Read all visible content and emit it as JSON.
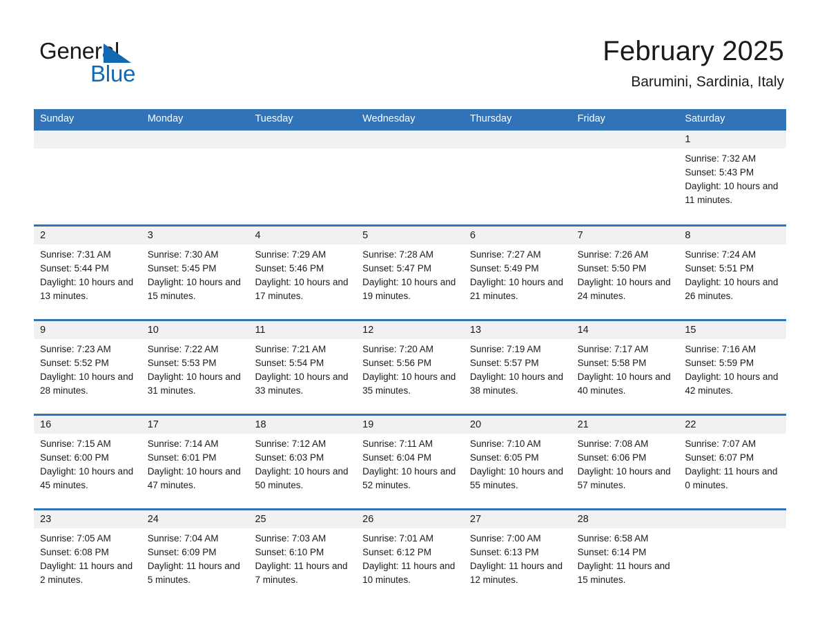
{
  "brand": {
    "name_top": "General",
    "name_bottom": "Blue",
    "triangle_color": "#1268b3",
    "accent_color": "#3173b8"
  },
  "header": {
    "month_title": "February 2025",
    "location": "Barumini, Sardinia, Italy"
  },
  "calendar": {
    "weekday_headers": [
      "Sunday",
      "Monday",
      "Tuesday",
      "Wednesday",
      "Thursday",
      "Friday",
      "Saturday"
    ],
    "weeks": [
      {
        "days": [
          {
            "num": "",
            "sunrise": "",
            "sunset": "",
            "daylight": ""
          },
          {
            "num": "",
            "sunrise": "",
            "sunset": "",
            "daylight": ""
          },
          {
            "num": "",
            "sunrise": "",
            "sunset": "",
            "daylight": ""
          },
          {
            "num": "",
            "sunrise": "",
            "sunset": "",
            "daylight": ""
          },
          {
            "num": "",
            "sunrise": "",
            "sunset": "",
            "daylight": ""
          },
          {
            "num": "",
            "sunrise": "",
            "sunset": "",
            "daylight": ""
          },
          {
            "num": "1",
            "sunrise": "Sunrise: 7:32 AM",
            "sunset": "Sunset: 5:43 PM",
            "daylight": "Daylight: 10 hours and 11 minutes."
          }
        ]
      },
      {
        "days": [
          {
            "num": "2",
            "sunrise": "Sunrise: 7:31 AM",
            "sunset": "Sunset: 5:44 PM",
            "daylight": "Daylight: 10 hours and 13 minutes."
          },
          {
            "num": "3",
            "sunrise": "Sunrise: 7:30 AM",
            "sunset": "Sunset: 5:45 PM",
            "daylight": "Daylight: 10 hours and 15 minutes."
          },
          {
            "num": "4",
            "sunrise": "Sunrise: 7:29 AM",
            "sunset": "Sunset: 5:46 PM",
            "daylight": "Daylight: 10 hours and 17 minutes."
          },
          {
            "num": "5",
            "sunrise": "Sunrise: 7:28 AM",
            "sunset": "Sunset: 5:47 PM",
            "daylight": "Daylight: 10 hours and 19 minutes."
          },
          {
            "num": "6",
            "sunrise": "Sunrise: 7:27 AM",
            "sunset": "Sunset: 5:49 PM",
            "daylight": "Daylight: 10 hours and 21 minutes."
          },
          {
            "num": "7",
            "sunrise": "Sunrise: 7:26 AM",
            "sunset": "Sunset: 5:50 PM",
            "daylight": "Daylight: 10 hours and 24 minutes."
          },
          {
            "num": "8",
            "sunrise": "Sunrise: 7:24 AM",
            "sunset": "Sunset: 5:51 PM",
            "daylight": "Daylight: 10 hours and 26 minutes."
          }
        ]
      },
      {
        "days": [
          {
            "num": "9",
            "sunrise": "Sunrise: 7:23 AM",
            "sunset": "Sunset: 5:52 PM",
            "daylight": "Daylight: 10 hours and 28 minutes."
          },
          {
            "num": "10",
            "sunrise": "Sunrise: 7:22 AM",
            "sunset": "Sunset: 5:53 PM",
            "daylight": "Daylight: 10 hours and 31 minutes."
          },
          {
            "num": "11",
            "sunrise": "Sunrise: 7:21 AM",
            "sunset": "Sunset: 5:54 PM",
            "daylight": "Daylight: 10 hours and 33 minutes."
          },
          {
            "num": "12",
            "sunrise": "Sunrise: 7:20 AM",
            "sunset": "Sunset: 5:56 PM",
            "daylight": "Daylight: 10 hours and 35 minutes."
          },
          {
            "num": "13",
            "sunrise": "Sunrise: 7:19 AM",
            "sunset": "Sunset: 5:57 PM",
            "daylight": "Daylight: 10 hours and 38 minutes."
          },
          {
            "num": "14",
            "sunrise": "Sunrise: 7:17 AM",
            "sunset": "Sunset: 5:58 PM",
            "daylight": "Daylight: 10 hours and 40 minutes."
          },
          {
            "num": "15",
            "sunrise": "Sunrise: 7:16 AM",
            "sunset": "Sunset: 5:59 PM",
            "daylight": "Daylight: 10 hours and 42 minutes."
          }
        ]
      },
      {
        "days": [
          {
            "num": "16",
            "sunrise": "Sunrise: 7:15 AM",
            "sunset": "Sunset: 6:00 PM",
            "daylight": "Daylight: 10 hours and 45 minutes."
          },
          {
            "num": "17",
            "sunrise": "Sunrise: 7:14 AM",
            "sunset": "Sunset: 6:01 PM",
            "daylight": "Daylight: 10 hours and 47 minutes."
          },
          {
            "num": "18",
            "sunrise": "Sunrise: 7:12 AM",
            "sunset": "Sunset: 6:03 PM",
            "daylight": "Daylight: 10 hours and 50 minutes."
          },
          {
            "num": "19",
            "sunrise": "Sunrise: 7:11 AM",
            "sunset": "Sunset: 6:04 PM",
            "daylight": "Daylight: 10 hours and 52 minutes."
          },
          {
            "num": "20",
            "sunrise": "Sunrise: 7:10 AM",
            "sunset": "Sunset: 6:05 PM",
            "daylight": "Daylight: 10 hours and 55 minutes."
          },
          {
            "num": "21",
            "sunrise": "Sunrise: 7:08 AM",
            "sunset": "Sunset: 6:06 PM",
            "daylight": "Daylight: 10 hours and 57 minutes."
          },
          {
            "num": "22",
            "sunrise": "Sunrise: 7:07 AM",
            "sunset": "Sunset: 6:07 PM",
            "daylight": "Daylight: 11 hours and 0 minutes."
          }
        ]
      },
      {
        "days": [
          {
            "num": "23",
            "sunrise": "Sunrise: 7:05 AM",
            "sunset": "Sunset: 6:08 PM",
            "daylight": "Daylight: 11 hours and 2 minutes."
          },
          {
            "num": "24",
            "sunrise": "Sunrise: 7:04 AM",
            "sunset": "Sunset: 6:09 PM",
            "daylight": "Daylight: 11 hours and 5 minutes."
          },
          {
            "num": "25",
            "sunrise": "Sunrise: 7:03 AM",
            "sunset": "Sunset: 6:10 PM",
            "daylight": "Daylight: 11 hours and 7 minutes."
          },
          {
            "num": "26",
            "sunrise": "Sunrise: 7:01 AM",
            "sunset": "Sunset: 6:12 PM",
            "daylight": "Daylight: 11 hours and 10 minutes."
          },
          {
            "num": "27",
            "sunrise": "Sunrise: 7:00 AM",
            "sunset": "Sunset: 6:13 PM",
            "daylight": "Daylight: 11 hours and 12 minutes."
          },
          {
            "num": "28",
            "sunrise": "Sunrise: 6:58 AM",
            "sunset": "Sunset: 6:14 PM",
            "daylight": "Daylight: 11 hours and 15 minutes."
          },
          {
            "num": "",
            "sunrise": "",
            "sunset": "",
            "daylight": ""
          }
        ]
      }
    ]
  }
}
